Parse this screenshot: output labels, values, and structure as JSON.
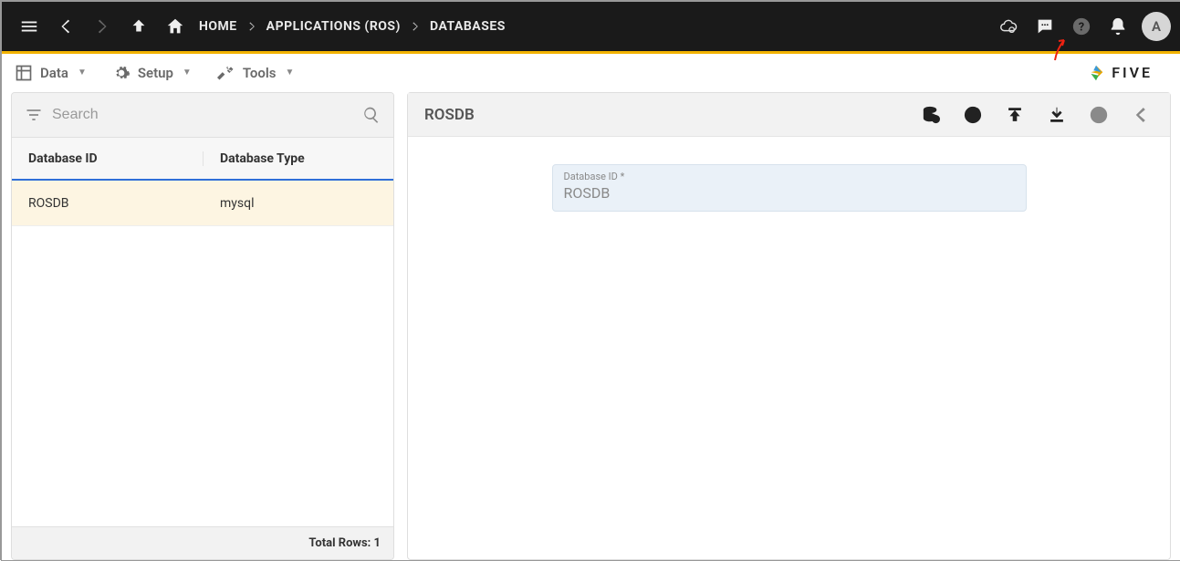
{
  "topbar": {
    "home_label": "HOME",
    "crumb_app": "APPLICATIONS (ROS)",
    "crumb_db": "DATABASES",
    "avatar_initial": "A"
  },
  "menubar": {
    "data": "Data",
    "setup": "Setup",
    "tools": "Tools",
    "brand": "FIVE"
  },
  "sidebar": {
    "search_placeholder": "Search",
    "columns": {
      "id": "Database ID",
      "type": "Database Type"
    },
    "rows": [
      {
        "id": "ROSDB",
        "type": "mysql"
      }
    ],
    "footer_label": "Total Rows: 1"
  },
  "detail": {
    "title": "ROSDB",
    "field_label": "Database ID *",
    "field_value": "ROSDB"
  }
}
